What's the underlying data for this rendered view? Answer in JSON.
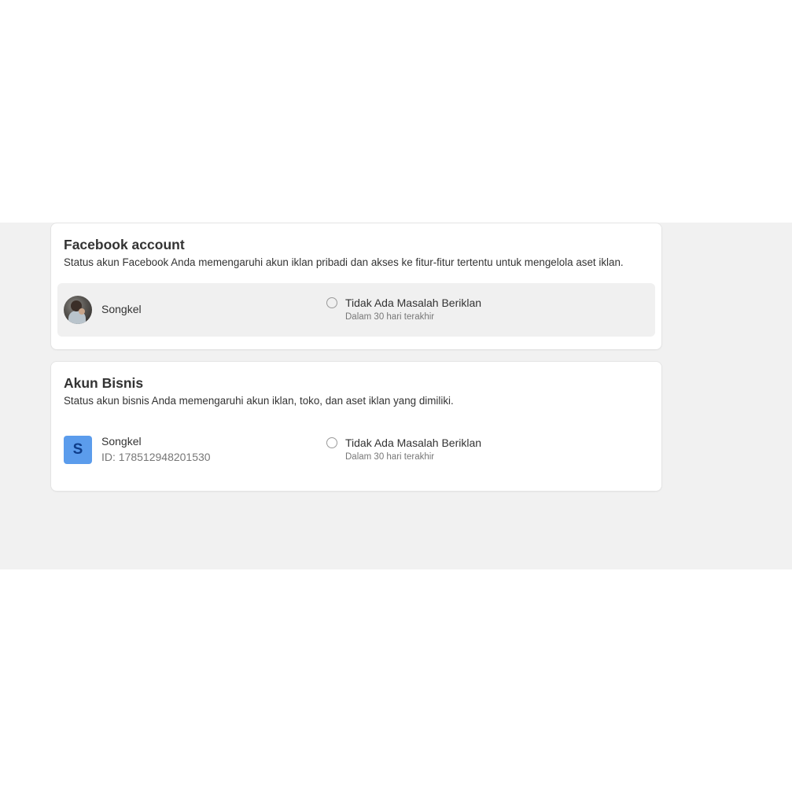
{
  "facebook_account": {
    "title": "Facebook account",
    "description": "Status akun Facebook Anda memengaruhi akun iklan pribadi dan akses ke fitur-fitur tertentu untuk mengelola aset iklan.",
    "name": "Songkel",
    "status": "Tidak Ada Masalah Beriklan",
    "status_period": "Dalam 30 hari terakhir",
    "avatar_icon": "profile-photo"
  },
  "business_account": {
    "title": "Akun Bisnis",
    "description": "Status akun bisnis Anda memengaruhi akun iklan, toko, dan aset iklan yang dimiliki.",
    "avatar_letter": "S",
    "name": "Songkel",
    "id_text": "ID: 178512948201530",
    "status": "Tidak Ada Masalah Beriklan",
    "status_period": "Dalam 30 hari terakhir"
  },
  "colors": {
    "background_band": "#f1f1f1",
    "card": "#ffffff",
    "row_highlight": "#f0f0f0",
    "business_avatar": "#5b9cec",
    "business_avatar_letter": "#0e3d8a"
  }
}
